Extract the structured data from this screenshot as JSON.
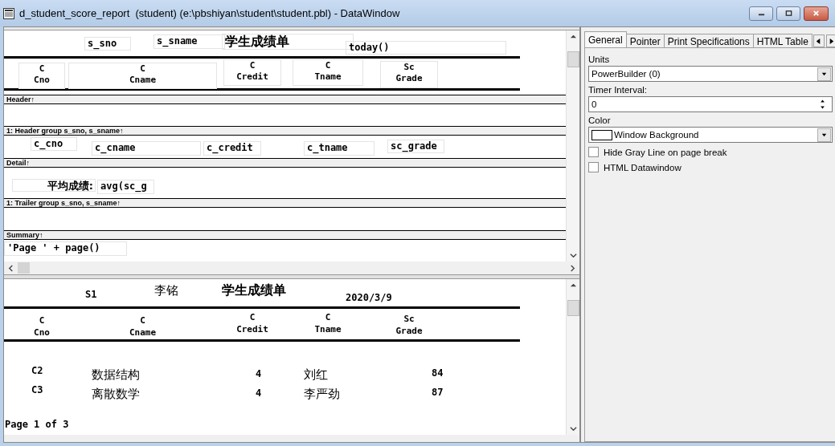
{
  "window": {
    "title": "d_student_score_report  (student) (e:\\pbshiyan\\student\\student.pbl) - DataWindow"
  },
  "design": {
    "bands": [
      {
        "label": "Header↑",
        "controls": [
          {
            "text": "s_sno"
          },
          {
            "text": "s_sname"
          },
          {
            "text": "学生成绩单",
            "kind": "title"
          },
          {
            "text": "today()",
            "kind": "bold"
          },
          {
            "lines": [
              "C",
              "Cno"
            ],
            "kind": "heading"
          },
          {
            "lines": [
              "C",
              "Cname"
            ],
            "kind": "heading"
          },
          {
            "lines": [
              "C",
              "Credit"
            ],
            "kind": "heading"
          },
          {
            "lines": [
              "C",
              "Tname"
            ],
            "kind": "heading"
          },
          {
            "lines": [
              "Sc",
              "Grade"
            ],
            "kind": "heading"
          }
        ]
      },
      {
        "label": "1: Header group s_sno, s_sname↑"
      },
      {
        "label": "Detail↑",
        "controls": [
          {
            "text": "c_cno"
          },
          {
            "text": "c_cname"
          },
          {
            "text": "c_credit"
          },
          {
            "text": "c_tname"
          },
          {
            "text": "sc_grade"
          }
        ]
      },
      {
        "label": "1: Trailer group s_sno, s_sname↑",
        "controls": [
          {
            "text": "平均成绩:",
            "kind": "cjk"
          },
          {
            "text": "avg(sc_g",
            "kind": "bold"
          }
        ]
      },
      {
        "label": "Summary↑"
      },
      {
        "controls": [
          {
            "text": "'Page ' + page()",
            "kind": "bold"
          }
        ]
      }
    ]
  },
  "preview": {
    "header": [
      "S1",
      "李铭",
      "学生成绩单",
      "2020/3/9"
    ],
    "columns": [
      {
        "lines": [
          "C",
          "Cno"
        ]
      },
      {
        "lines": [
          "C",
          "Cname"
        ]
      },
      {
        "lines": [
          "C",
          "Credit"
        ]
      },
      {
        "lines": [
          "C",
          "Tname"
        ]
      },
      {
        "lines": [
          "Sc",
          "Grade"
        ]
      }
    ],
    "rows": [
      [
        "C2",
        "数据结构",
        "4",
        "刘红",
        "84"
      ],
      [
        "C3",
        "离散数学",
        "4",
        "李严劲",
        "87"
      ]
    ],
    "footer": "Page 1 of 3"
  },
  "properties": {
    "tabs": [
      {
        "label": "General",
        "selected": true
      },
      {
        "label": "Pointer",
        "selected": false
      },
      {
        "label": "Print Specifications",
        "selected": false
      },
      {
        "label": "HTML Table",
        "selected": false
      }
    ],
    "fields": [
      {
        "kind": "dropdown",
        "label": "Units",
        "value": "PowerBuilder (0)"
      },
      {
        "kind": "spinner",
        "label": "Timer Interval:",
        "value": "0"
      },
      {
        "kind": "color",
        "label": "Color",
        "value": "Window Background"
      },
      {
        "kind": "checkbox",
        "label": "Hide Gray Line on page break",
        "checked": false
      },
      {
        "kind": "checkbox",
        "label": "HTML Datawindow",
        "checked": false
      }
    ]
  }
}
